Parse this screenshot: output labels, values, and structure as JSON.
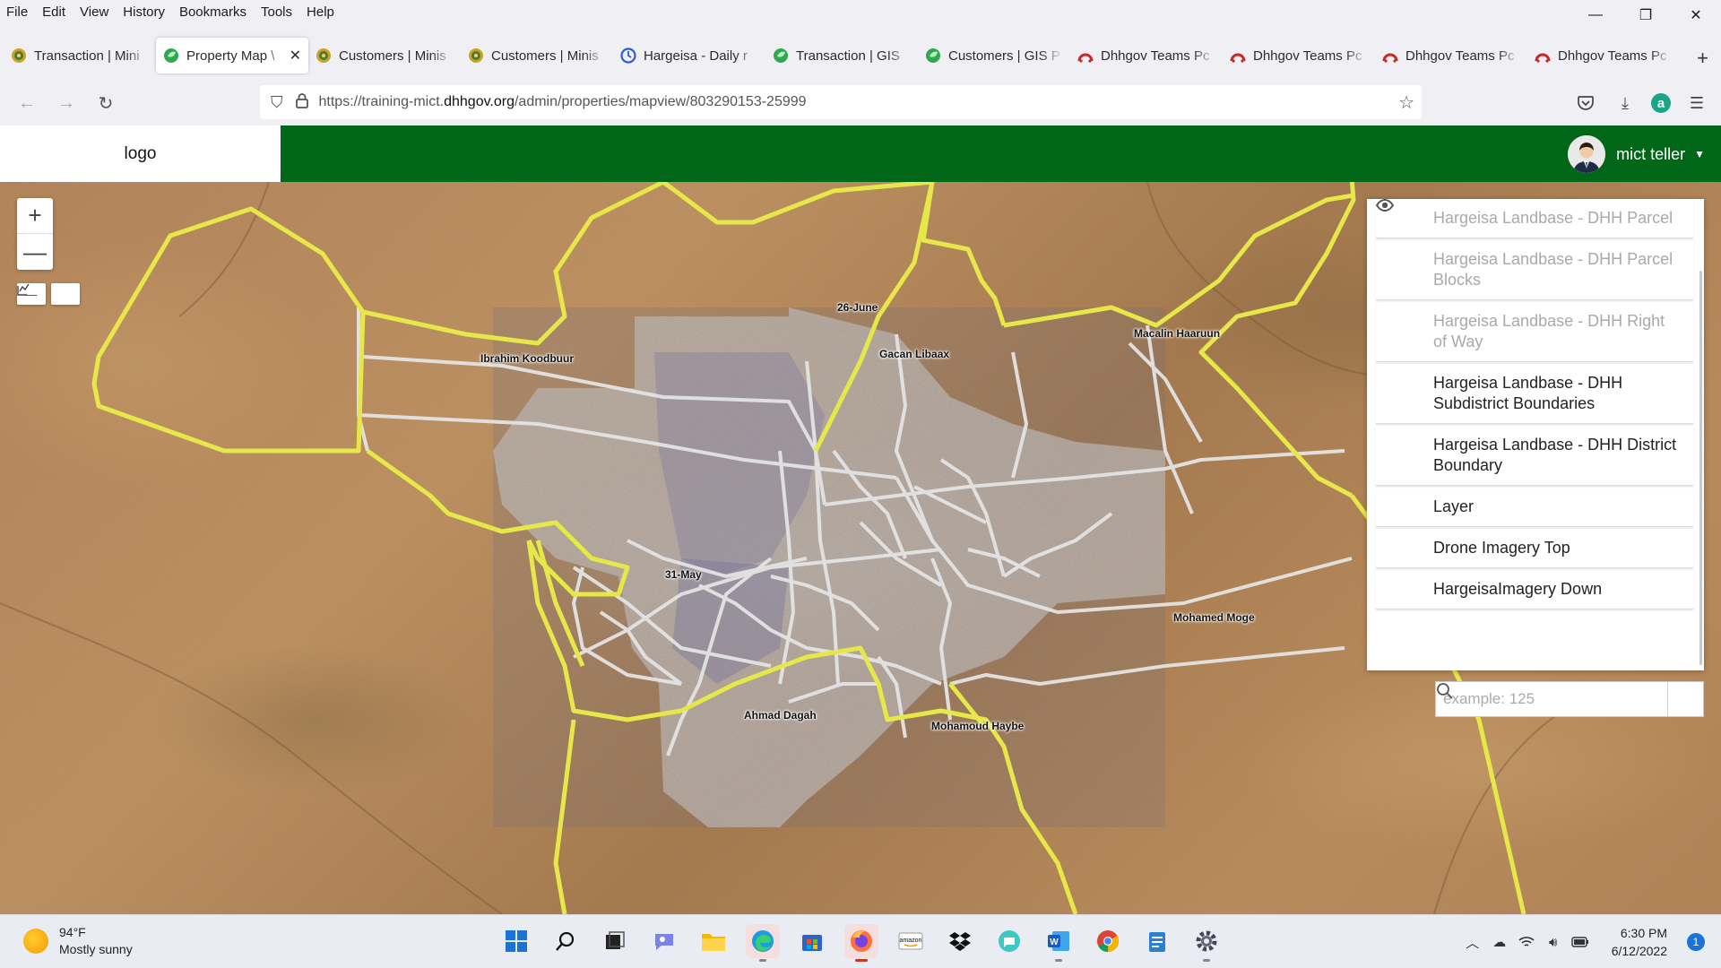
{
  "menubar": {
    "items": [
      "File",
      "Edit",
      "View",
      "History",
      "Bookmarks",
      "Tools",
      "Help"
    ]
  },
  "window_controls": {
    "minimize": "—",
    "restore": "❐",
    "close": "✕"
  },
  "tabs": [
    {
      "label": "Transaction | Mini",
      "favicon": "ministry-seal-icon"
    },
    {
      "label": "Property Map \\",
      "favicon": "green-leaf-icon",
      "active": true
    },
    {
      "label": "Customers | Minis",
      "favicon": "ministry-seal-icon"
    },
    {
      "label": "Customers | Minis",
      "favicon": "ministry-seal-icon"
    },
    {
      "label": "Hargeisa - Daily r",
      "favicon": "blue-clock-icon"
    },
    {
      "label": "Transaction | GIS",
      "favicon": "green-leaf-icon"
    },
    {
      "label": "Customers | GIS P",
      "favicon": "green-leaf-icon"
    },
    {
      "label": "Dhhgov Teams Pc",
      "favicon": "red-arc-icon"
    },
    {
      "label": "Dhhgov Teams Pc",
      "favicon": "red-arc-icon"
    },
    {
      "label": "Dhhgov Teams Pc",
      "favicon": "red-arc-icon"
    },
    {
      "label": "Dhhgov Teams Pc",
      "favicon": "red-arc-icon"
    }
  ],
  "new_tab": "+",
  "urlbar": {
    "prefix": "https://training-mict.",
    "host": "dhhgov.org",
    "path": "/admin/properties/mapview/803290153-25999"
  },
  "app": {
    "logo": "logo",
    "user_name": "mict teller"
  },
  "map": {
    "zoom_in": "+",
    "zoom_out": "—",
    "district_labels": [
      {
        "name": "26-June"
      },
      {
        "name": "Ibrahim Koodbuur"
      },
      {
        "name": "Gacan Libaax"
      },
      {
        "name": "Macalin Haaruun"
      },
      {
        "name": "31-May"
      },
      {
        "name": "Mohamed Moge"
      },
      {
        "name": "Ahmad Dagah"
      },
      {
        "name": "Mohamoud Haybe"
      }
    ],
    "colors": {
      "district_boundary": "#e6e84a",
      "subdistrict_boundary": "#e4e4e4"
    }
  },
  "layers": [
    {
      "label": "Hargeisa Landbase - DHH Parcel",
      "enabled": false
    },
    {
      "label": "Hargeisa Landbase - DHH Parcel Blocks",
      "enabled": false
    },
    {
      "label": "Hargeisa Landbase - DHH Right of Way",
      "enabled": false
    },
    {
      "label": "Hargeisa Landbase - DHH Subdistrict Boundaries",
      "enabled": true
    },
    {
      "label": "Hargeisa Landbase - DHH District Boundary",
      "enabled": true
    },
    {
      "label": "Layer",
      "enabled": true
    },
    {
      "label": "Drone Imagery Top",
      "enabled": true
    },
    {
      "label": "HargeisaImagery Down",
      "enabled": true
    }
  ],
  "search": {
    "placeholder": "example: 125",
    "value": ""
  },
  "taskbar": {
    "weather_temp": "94°F",
    "weather_desc": "Mostly sunny",
    "time": "6:30 PM",
    "date": "6/12/2022",
    "notification_count": "1"
  }
}
